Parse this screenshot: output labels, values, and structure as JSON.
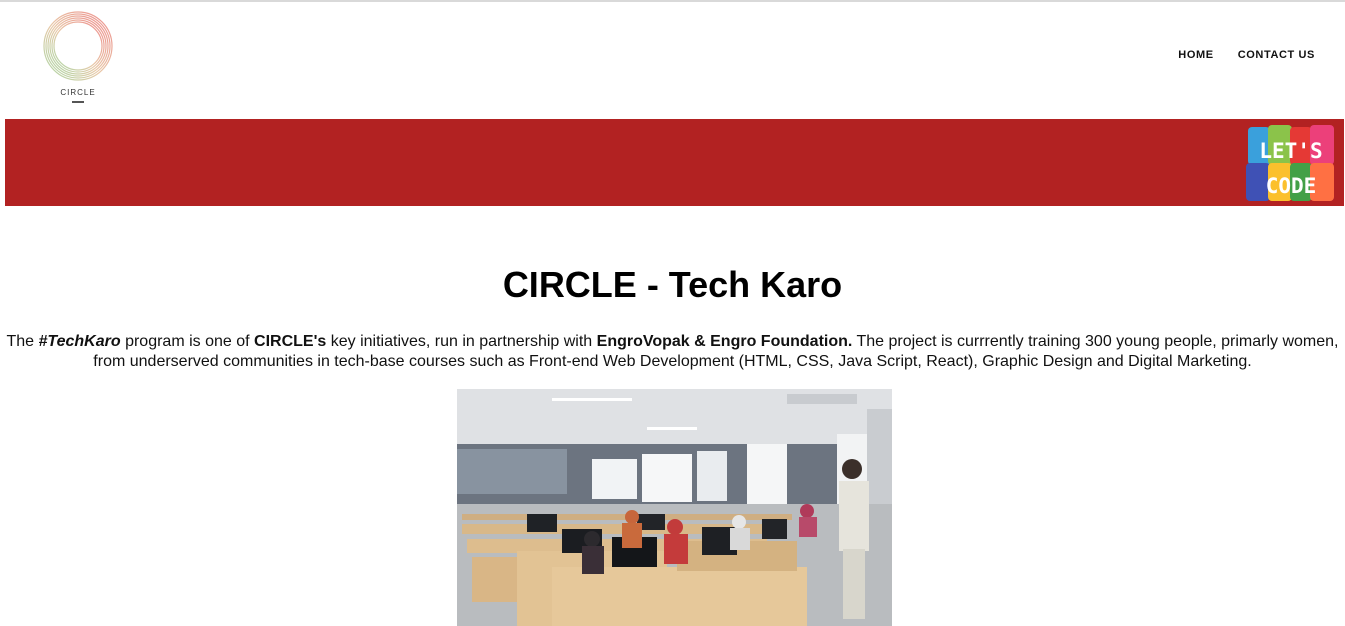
{
  "logo": {
    "text": "CIRCLE"
  },
  "nav": {
    "items": [
      {
        "label": "HOME"
      },
      {
        "label": "CONTACT US"
      }
    ]
  },
  "banner": {
    "color": "#b22222",
    "badge": {
      "line1": "LET'S",
      "line2": "CODE"
    }
  },
  "main": {
    "title": "CIRCLE - Tech Karo",
    "intro": {
      "p1": "The ",
      "techkaro": "#TechKaro",
      "p2": " program is one of ",
      "circle": "CIRCLE's",
      "p3": " key initiatives, run in partnership with ",
      "partners": "EngroVopak & Engro Foundation.",
      "p4": " The project is currrently training 300 young people, primarly women, from underserved communities in tech-base courses such as Front-end Web Development (HTML, CSS, Java Script, React), Graphic Design and Digital Marketing."
    }
  }
}
